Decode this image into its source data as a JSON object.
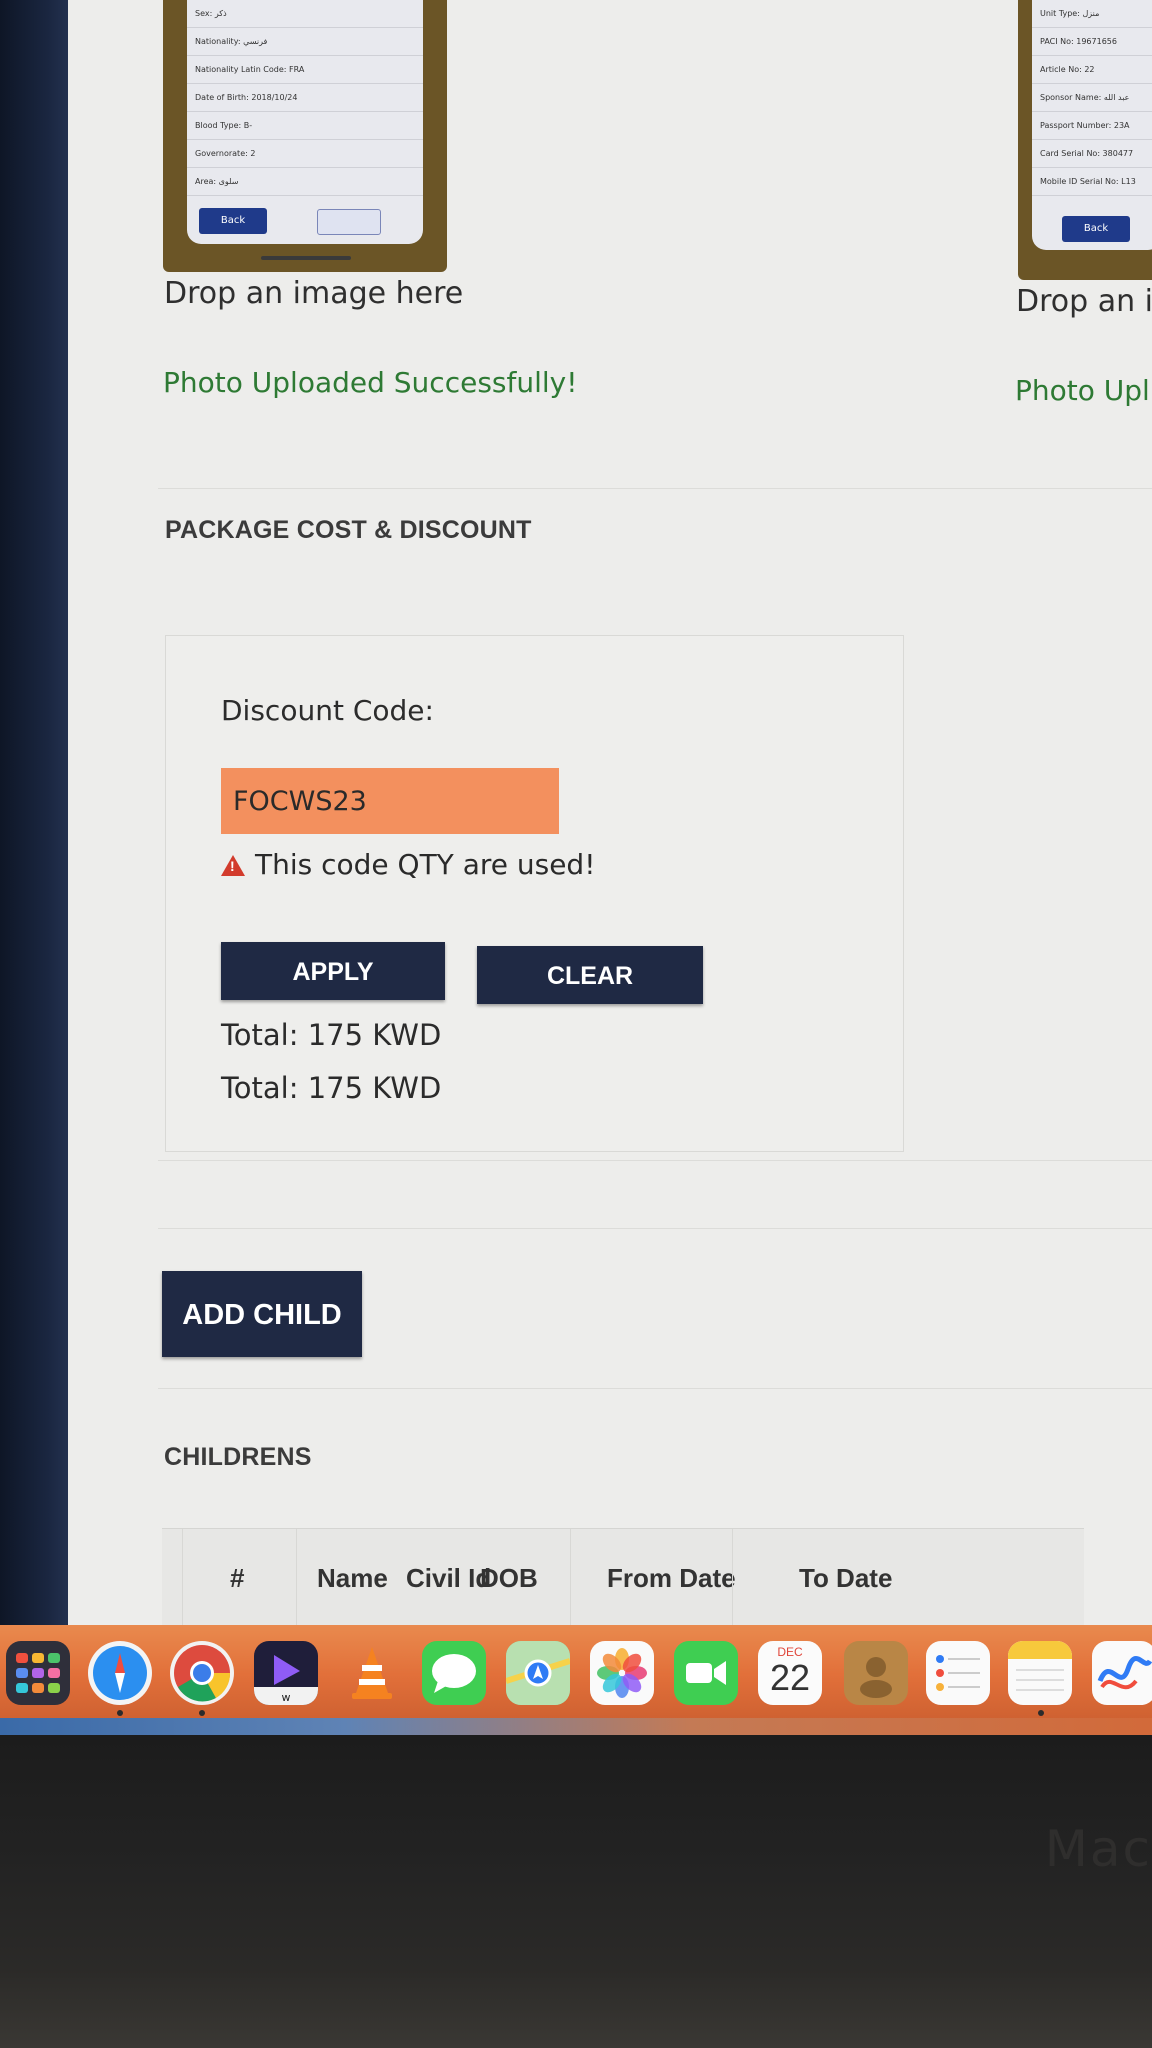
{
  "thumbnails": {
    "left": {
      "rows": [
        "Sex: ذكر",
        "Nationality: فرنسي",
        "Nationality Latin Code: FRA",
        "Date of Birth: 2018/10/24",
        "Blood Type: B-",
        "Governorate: 2",
        "Area: سلوى"
      ],
      "back_label": "Back"
    },
    "right": {
      "rows": [
        "Unit Type: منزل",
        "PACI No: 19671656",
        "Article No: 22",
        "Sponsor Name: عبد الله",
        "Passport Number: 23A",
        "Card Serial No: 380477",
        "Mobile ID Serial No: L13"
      ],
      "back_label": "Back"
    }
  },
  "upload": {
    "drop_text_1": "Drop an image here",
    "drop_text_2": "Drop an ir",
    "success_1": "Photo Uploaded Successfully!",
    "success_2": "Photo Upl"
  },
  "package": {
    "section_title": "PACKAGE COST & DISCOUNT",
    "discount_label": "Discount Code:",
    "discount_value": "FOCWS23",
    "error_message": "This code QTY are used!",
    "apply_label": "APPLY",
    "clear_label": "CLEAR",
    "total_1": "Total: 175 KWD",
    "total_2": "Total: 175 KWD",
    "input_color": "#f3905e",
    "button_color": "#1f2944"
  },
  "children": {
    "add_child_label": "ADD CHILD",
    "section_title": "CHILDRENS",
    "columns": [
      "#",
      "Name",
      "Civil Id",
      "DOB",
      "From Date",
      "To Date"
    ]
  },
  "dock": {
    "apps": [
      "launchpad-icon",
      "safari-icon",
      "chrome-icon",
      "app-w-icon",
      "vlc-icon",
      "messages-icon",
      "maps-icon",
      "photos-icon",
      "facetime-icon",
      "calendar-icon",
      "contacts-icon",
      "reminders-icon",
      "notes-icon",
      "freeform-icon"
    ],
    "calendar_month": "DEC",
    "calendar_day": "22"
  },
  "bezel": {
    "logo_text": "Mac"
  }
}
